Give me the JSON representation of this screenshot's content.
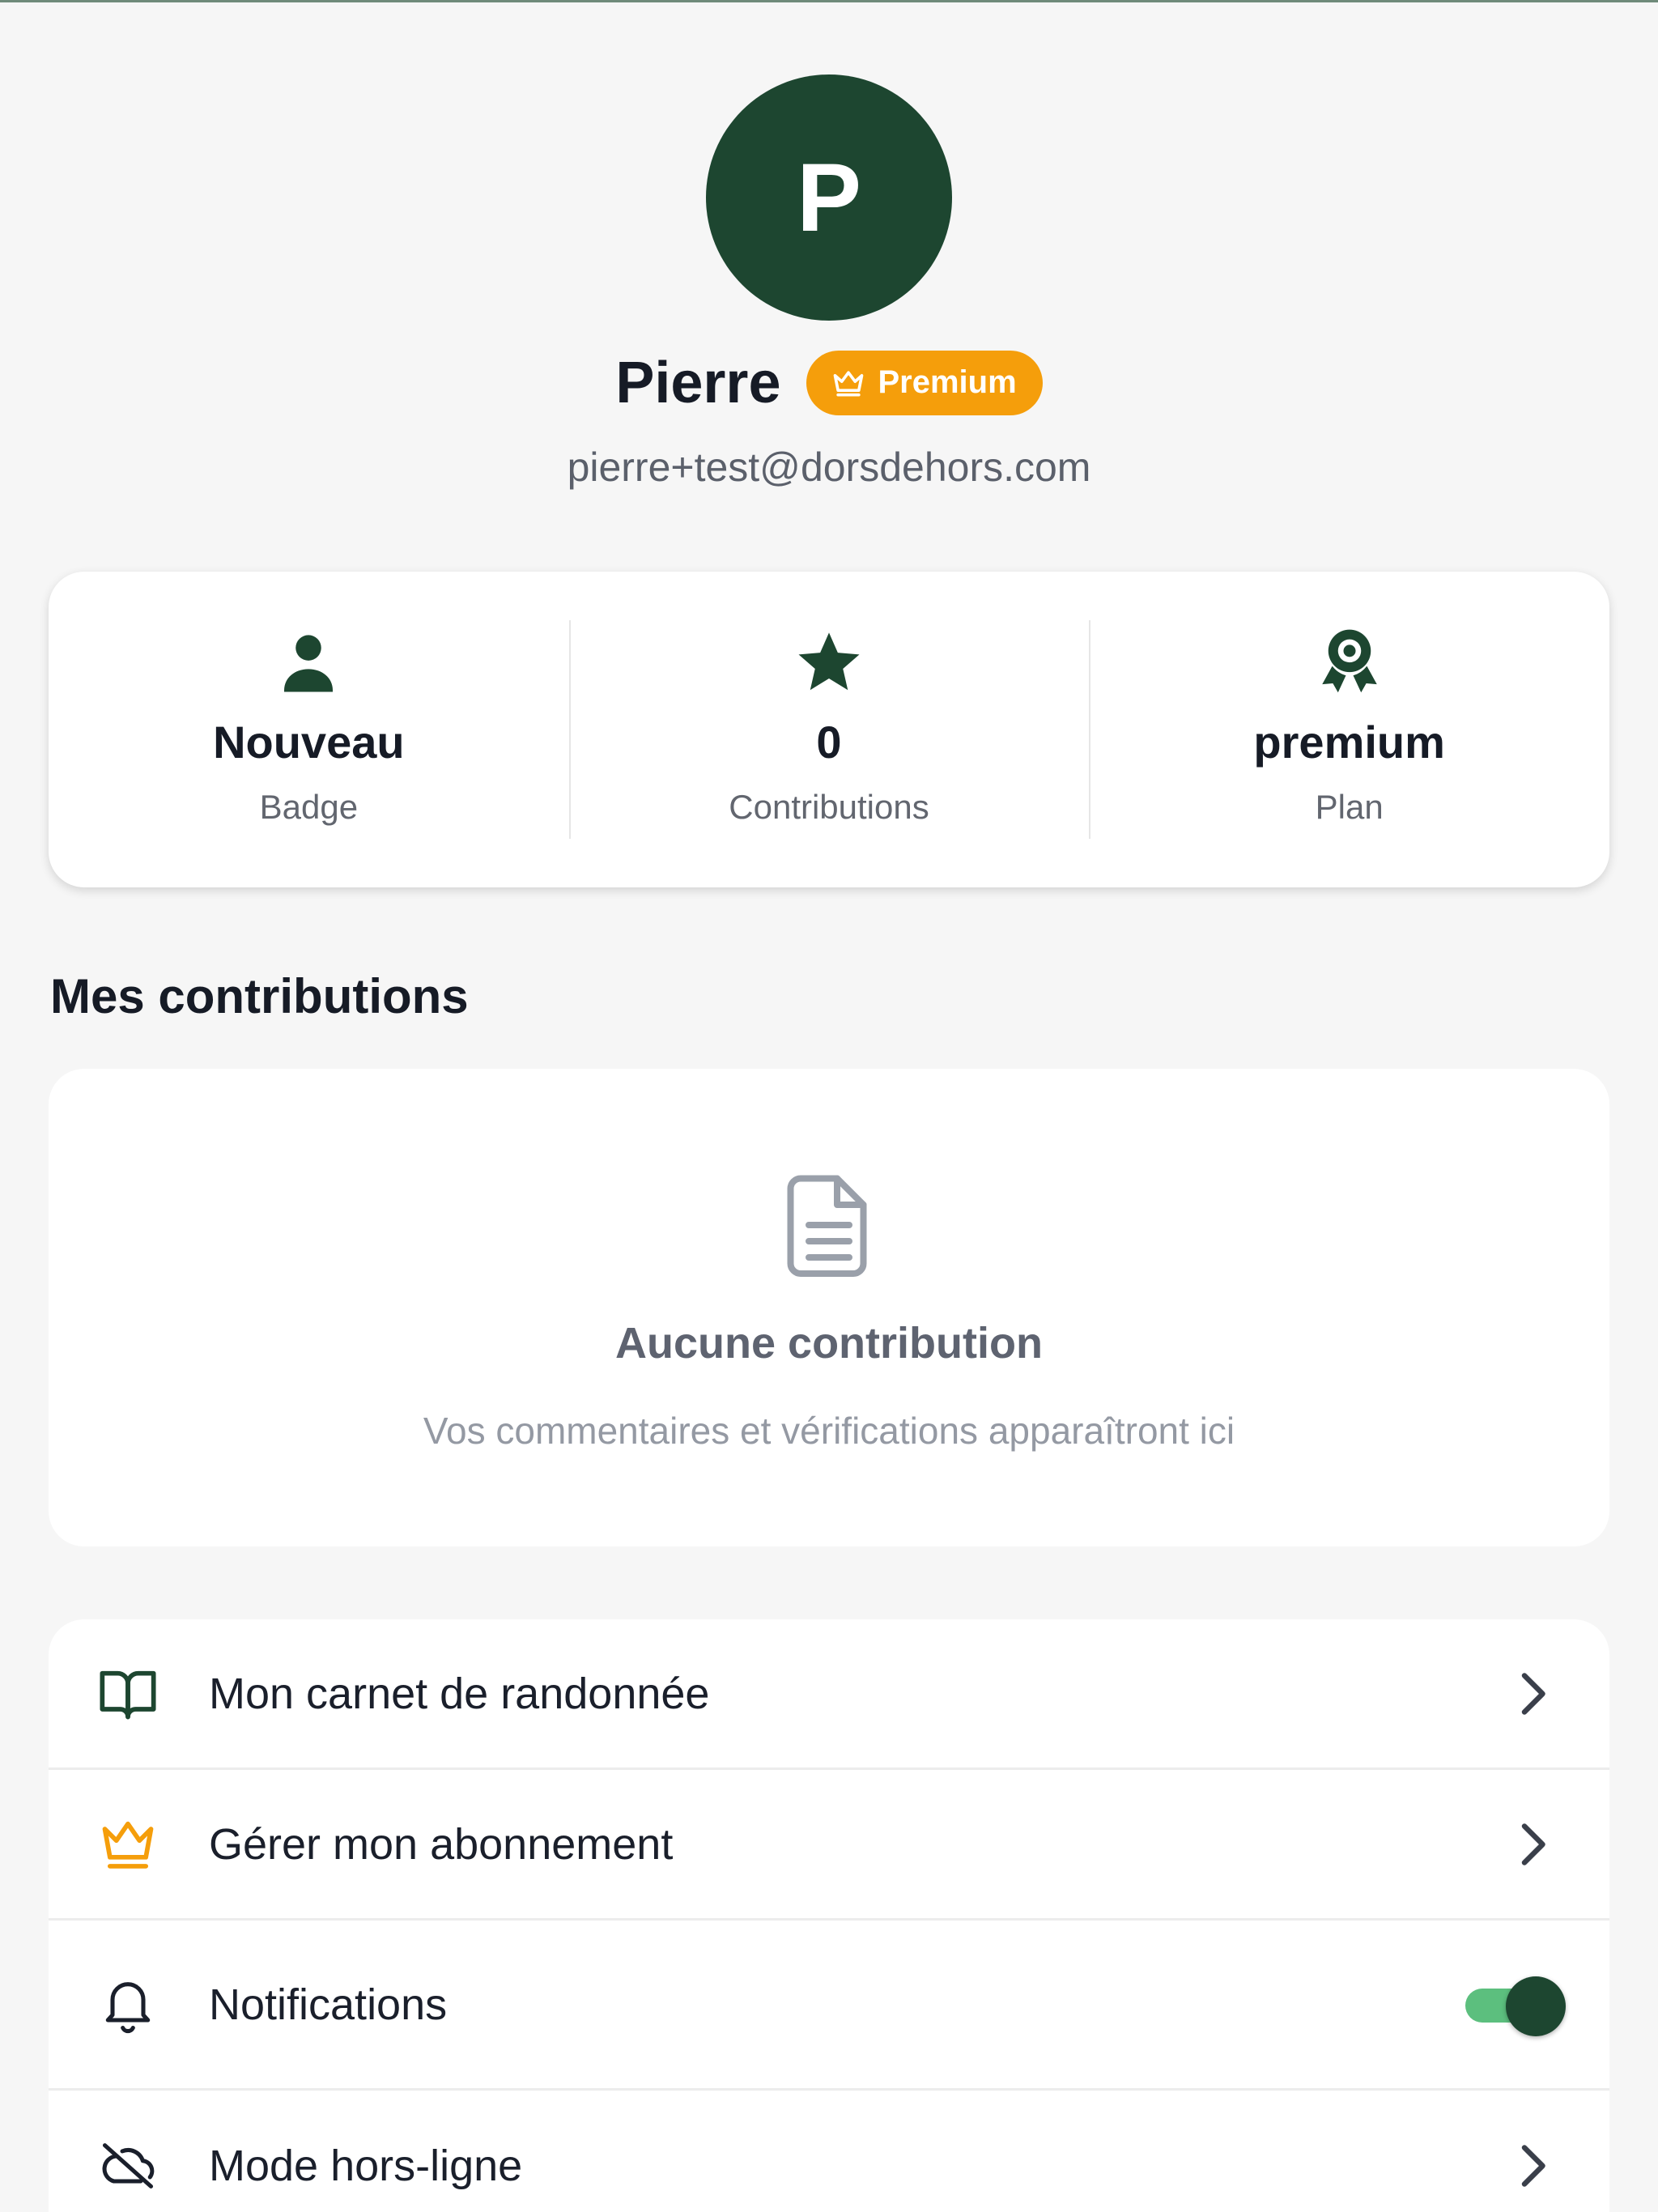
{
  "profile": {
    "initial": "P",
    "name": "Pierre",
    "badge_label": "Premium",
    "email": "pierre+test@dorsdehors.com"
  },
  "stats": [
    {
      "icon": "user-icon",
      "value": "Nouveau",
      "label": "Badge"
    },
    {
      "icon": "star-icon",
      "value": "0",
      "label": "Contributions"
    },
    {
      "icon": "award-icon",
      "value": "premium",
      "label": "Plan"
    }
  ],
  "contributions": {
    "section_title": "Mes contributions",
    "empty_icon": "document-icon",
    "empty_title": "Aucune contribution",
    "empty_subtitle": "Vos commentaires et vérifications apparaîtront ici"
  },
  "menu": {
    "items": [
      {
        "icon": "book-icon",
        "label": "Mon carnet de randonnée",
        "control": "chevron"
      },
      {
        "icon": "crown-icon",
        "label": "Gérer mon abonnement",
        "control": "chevron"
      },
      {
        "icon": "bell-icon",
        "label": "Notifications",
        "control": "toggle",
        "toggle_on": true
      },
      {
        "icon": "cloud-off-icon",
        "label": "Mode hors-ligne",
        "control": "chevron"
      }
    ]
  },
  "colors": {
    "brand_green": "#1d4630",
    "premium_orange": "#f59e0b",
    "toggle_track": "#5cbf7e",
    "background": "#f6f6f6"
  }
}
